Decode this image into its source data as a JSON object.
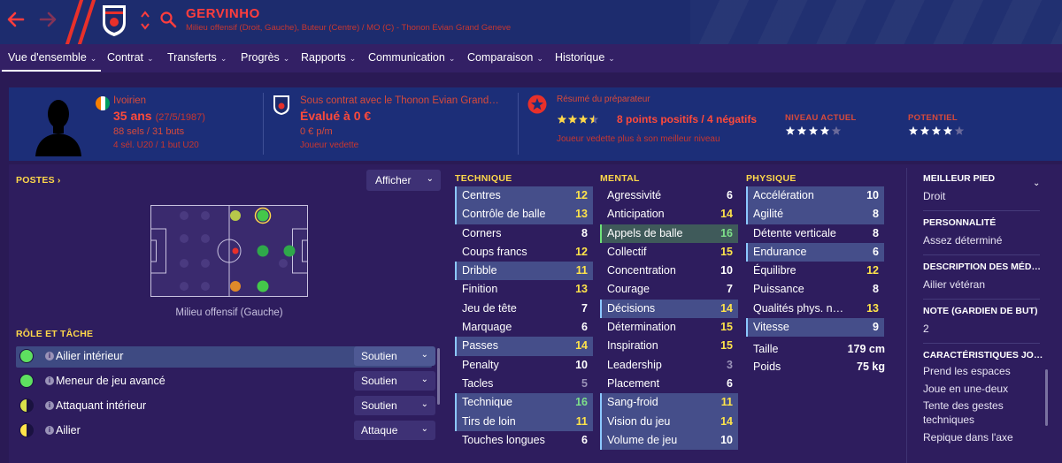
{
  "header": {
    "player_name": "GERVINHO",
    "subtitle": "Milieu offensif (Droit, Gauche), Buteur (Centre) / MO (C) - Thonon Evian Grand Geneve"
  },
  "tabs": [
    {
      "label": "Vue d'ensemble",
      "active": true
    },
    {
      "label": "Contrat"
    },
    {
      "label": "Transferts"
    },
    {
      "label": "Progrès"
    },
    {
      "label": "Rapports"
    },
    {
      "label": "Communication"
    },
    {
      "label": "Comparaison"
    },
    {
      "label": "Historique"
    }
  ],
  "overview": {
    "nationality": "Ivoirien",
    "age": "35 ans",
    "dob": "(27/5/1987)",
    "caps": "88 sels / 31 buts",
    "youth": "4 sél. U20 / 1 but U20",
    "contract_status": "Sous contrat avec le Thonon Evian Grand…",
    "valuation": "Évalué à 0 €",
    "wage": "0 € p/m",
    "role_status": "Joueur vedette",
    "coach_title": "Résumé du préparateur",
    "coach_points": "8 points positifs / 4 négatifs",
    "coach_summary": "Joueur vedette plus à son meilleur niveau",
    "coach_rating": 3.5,
    "current_level_label": "NIVEAU ACTUEL",
    "current_level": 4,
    "potential_label": "POTENTIEL",
    "potential": 4,
    "colors": {
      "accent_red": "#ff4a3a",
      "band": "#1c2e78"
    }
  },
  "positions": {
    "title": "POSTES",
    "show_button": "Afficher",
    "caption": "Milieu offensif (Gauche)"
  },
  "roles": {
    "title": "RÔLE ET TÂCHE",
    "items": [
      {
        "name": "Ailier intérieur",
        "duty": "Soutien",
        "dot": "green",
        "selected": true
      },
      {
        "name": "Meneur de jeu avancé",
        "duty": "Soutien",
        "dot": "green"
      },
      {
        "name": "Attaquant intérieur",
        "duty": "Soutien",
        "dot": "half-yellow"
      },
      {
        "name": "Ailier",
        "duty": "Attaque",
        "dot": "half-yellow"
      }
    ]
  },
  "attributes": {
    "technical_title": "TECHNIQUE",
    "mental_title": "MENTAL",
    "physical_title": "PHYSIQUE",
    "technical": [
      {
        "name": "Centres",
        "value": "12",
        "color": "yellow",
        "hl": "blue"
      },
      {
        "name": "Contrôle de balle",
        "value": "13",
        "color": "yellow",
        "hl": "blue"
      },
      {
        "name": "Corners",
        "value": "8",
        "color": "white"
      },
      {
        "name": "Coups francs",
        "value": "12",
        "color": "yellow"
      },
      {
        "name": "Dribble",
        "value": "11",
        "color": "yellow",
        "hl": "blue"
      },
      {
        "name": "Finition",
        "value": "13",
        "color": "yellow"
      },
      {
        "name": "Jeu de tête",
        "value": "7",
        "color": "white"
      },
      {
        "name": "Marquage",
        "value": "6",
        "color": "white"
      },
      {
        "name": "Passes",
        "value": "14",
        "color": "yellow",
        "hl": "blue"
      },
      {
        "name": "Penalty",
        "value": "10",
        "color": "white"
      },
      {
        "name": "Tacles",
        "value": "5",
        "color": "grey"
      },
      {
        "name": "Technique",
        "value": "16",
        "color": "green",
        "hl": "blue"
      },
      {
        "name": "Tirs de loin",
        "value": "11",
        "color": "yellow",
        "hl": "blue"
      },
      {
        "name": "Touches longues",
        "value": "6",
        "color": "white"
      }
    ],
    "mental": [
      {
        "name": "Agressivité",
        "value": "6",
        "color": "white"
      },
      {
        "name": "Anticipation",
        "value": "14",
        "color": "yellow"
      },
      {
        "name": "Appels de balle",
        "value": "16",
        "color": "green",
        "hl": "green"
      },
      {
        "name": "Collectif",
        "value": "15",
        "color": "yellow"
      },
      {
        "name": "Concentration",
        "value": "10",
        "color": "white"
      },
      {
        "name": "Courage",
        "value": "7",
        "color": "white"
      },
      {
        "name": "Décisions",
        "value": "14",
        "color": "yellow",
        "hl": "blue"
      },
      {
        "name": "Détermination",
        "value": "15",
        "color": "yellow"
      },
      {
        "name": "Inspiration",
        "value": "15",
        "color": "yellow"
      },
      {
        "name": "Leadership",
        "value": "3",
        "color": "grey"
      },
      {
        "name": "Placement",
        "value": "6",
        "color": "white"
      },
      {
        "name": "Sang-froid",
        "value": "11",
        "color": "yellow",
        "hl": "blue"
      },
      {
        "name": "Vision du jeu",
        "value": "14",
        "color": "yellow",
        "hl": "blue"
      },
      {
        "name": "Volume de jeu",
        "value": "10",
        "color": "white",
        "hl": "blue"
      }
    ],
    "physical": [
      {
        "name": "Accélération",
        "value": "10",
        "color": "white",
        "hl": "blue"
      },
      {
        "name": "Agilité",
        "value": "8",
        "color": "white",
        "hl": "blue"
      },
      {
        "name": "Détente verticale",
        "value": "8",
        "color": "white"
      },
      {
        "name": "Endurance",
        "value": "6",
        "color": "white",
        "hl": "blue"
      },
      {
        "name": "Équilibre",
        "value": "12",
        "color": "yellow"
      },
      {
        "name": "Puissance",
        "value": "8",
        "color": "white"
      },
      {
        "name": "Qualités phys. n…",
        "value": "13",
        "color": "yellow"
      },
      {
        "name": "Vitesse",
        "value": "9",
        "color": "white",
        "hl": "blue"
      }
    ],
    "height_label": "Taille",
    "height": "179 cm",
    "weight_label": "Poids",
    "weight": "75 kg"
  },
  "info": {
    "best_foot_label": "MEILLEUR PIED",
    "best_foot": "Droit",
    "personality_label": "PERSONNALITÉ",
    "personality": "Assez déterminé",
    "media_label": "DESCRIPTION DES MÉD…",
    "media": "Ailier vétéran",
    "gk_label": "NOTE (GARDIEN DE BUT)",
    "gk_rating": "2",
    "traits_label": "CARACTÉRISTIQUES JO…",
    "traits": [
      "Prend les espaces",
      "Joue en une-deux",
      "Tente des gestes techniques",
      "Repique dans l'axe"
    ]
  }
}
